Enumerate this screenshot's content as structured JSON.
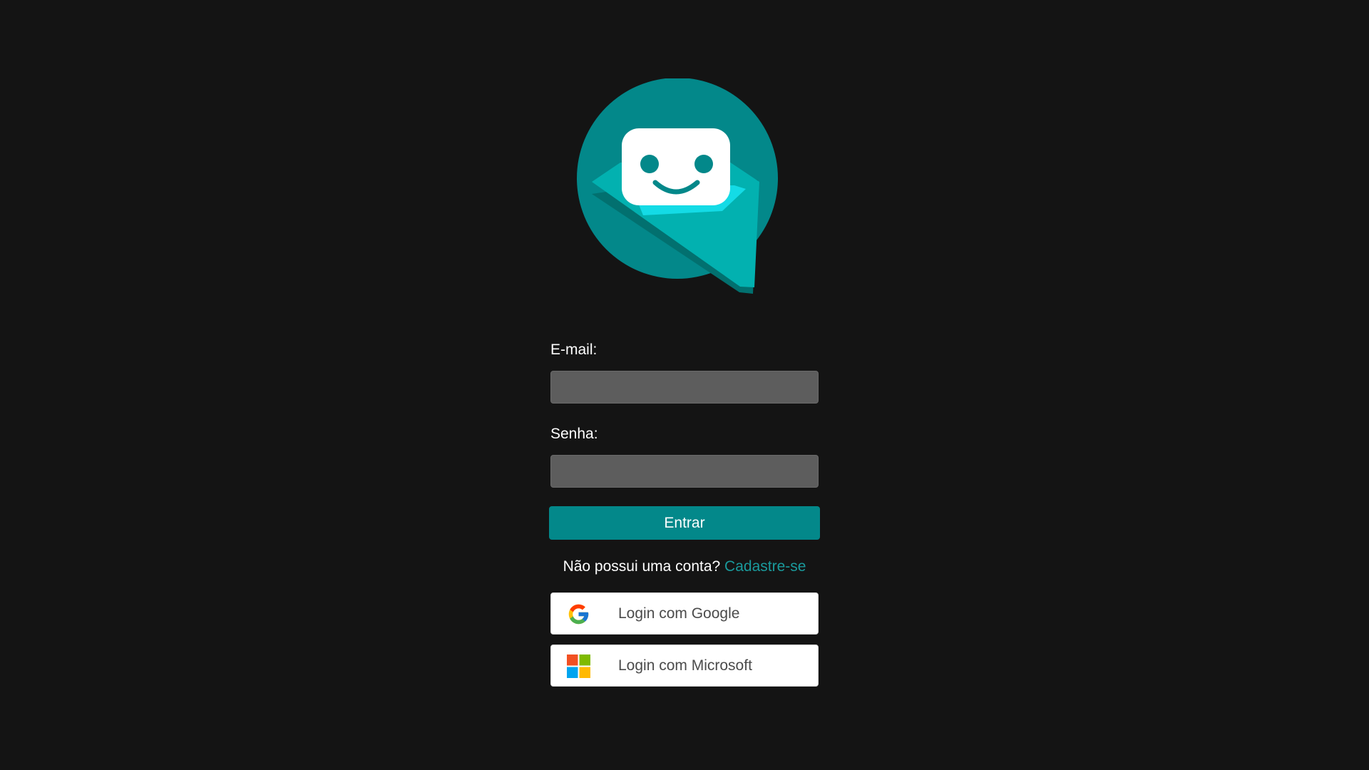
{
  "theme": {
    "background": "#141414",
    "accent": "#03888a",
    "link": "#1a9a9c",
    "input_background": "#5d5d5d"
  },
  "logo": {
    "icon": "smiling-robot-chat-bubble-icon",
    "colors": {
      "bubble": "#03888a",
      "tail_light": "#02b1b0",
      "tail_dark": "#02706f",
      "face": "#ffffff",
      "face_shadow": "#14dbe6"
    }
  },
  "login": {
    "email_label": "E-mail:",
    "email_value": "",
    "password_label": "Senha:",
    "password_value": "",
    "submit_label": "Entrar"
  },
  "signup": {
    "prompt": "Não possui uma conta?",
    "link_label": "Cadastre-se"
  },
  "social": {
    "google": {
      "label": "Login com Google",
      "icon": "google-g-icon"
    },
    "microsoft": {
      "label": "Login com Microsoft",
      "icon": "microsoft-logo-icon"
    }
  }
}
